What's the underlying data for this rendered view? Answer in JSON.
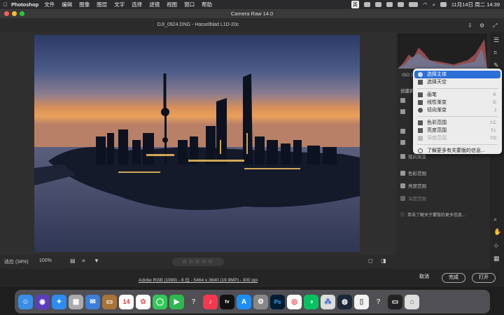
{
  "menubar": {
    "app_name": "Photoshop",
    "items": [
      "文件",
      "编辑",
      "图像",
      "图层",
      "文字",
      "选择",
      "滤镜",
      "视图",
      "窗口",
      "帮助"
    ],
    "input_method": "英",
    "datetime": "11月14日 周二  14:39"
  },
  "window": {
    "title": "Camera Raw 14.0"
  },
  "document": {
    "name": "DJI_0924.DNG - Hasselblad L1D-20c"
  },
  "bottom_toolbar": {
    "zoom_fit": "适应 (34%)",
    "zoom_100": "100%"
  },
  "footer": {
    "color_info": "Adobe RGB (1998) - 8 位 - 5464 x 3640 (19.9MP) - 300 ppi",
    "cancel": "取消",
    "done": "完成",
    "open": "打开"
  },
  "panel": {
    "iso_text": "ISO 1",
    "create_label": "创建新",
    "items": [
      "径向渐变",
      "色彩范围",
      "亮度范围",
      "深度范围"
    ],
    "info_link": "单击了解关于蒙版的更多信息..."
  },
  "mask_menu": {
    "items": [
      {
        "label": "选择主体",
        "shortcut": "",
        "icon": "person-icon",
        "selected": true
      },
      {
        "label": "选择天空",
        "shortcut": "",
        "icon": "sky-icon"
      },
      {
        "label": "画笔",
        "shortcut": "K",
        "icon": "brush-icon"
      },
      {
        "label": "线性渐变",
        "shortcut": "G",
        "icon": "linear-gradient-icon"
      },
      {
        "label": "径向渐变",
        "shortcut": "J",
        "icon": "radial-gradient-icon"
      },
      {
        "label": "色彩范围",
        "shortcut": "⇧C",
        "icon": "color-range-icon"
      },
      {
        "label": "亮度范围",
        "shortcut": "⇧L",
        "icon": "luminance-range-icon"
      },
      {
        "label": "深度范围",
        "shortcut": "⇧D",
        "icon": "depth-range-icon",
        "disabled": true
      },
      {
        "label": "了解更多有关蒙版的信息...",
        "shortcut": "",
        "icon": "help-icon"
      }
    ]
  },
  "dock": {
    "apps": [
      "finder-icon",
      "siri-icon",
      "safari-icon",
      "launchpad-icon",
      "mail-icon",
      "notes-icon",
      "calendar-icon",
      "photos-icon",
      "messages-icon",
      "facetime-icon",
      "unknown-icon",
      "music-icon",
      "tv-icon",
      "appstore-icon",
      "settings-icon",
      "photoshop-icon",
      "chrome-icon",
      "wechat-icon",
      "nodes-icon",
      "steam-icon",
      "files-icon",
      "unknown-icon",
      "terminal-icon",
      "trash-icon"
    ],
    "calendar_day": "14",
    "tv_label": "tv",
    "ps_label": "Ps"
  },
  "colors": {
    "accent": "#2d6fd8",
    "panel_bg": "#2b2b2b",
    "menu_bg": "#ececec"
  }
}
